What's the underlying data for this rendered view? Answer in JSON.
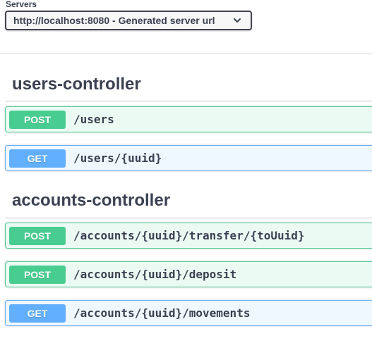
{
  "servers": {
    "label": "Servers",
    "selected": "http://localhost:8080 - Generated server url",
    "chevron_icon": "chevron-down-icon"
  },
  "sections": [
    {
      "title": "users-controller",
      "operations": [
        {
          "method": "POST",
          "path": "/users"
        },
        {
          "method": "GET",
          "path": "/users/{uuid}"
        }
      ]
    },
    {
      "title": "accounts-controller",
      "operations": [
        {
          "method": "POST",
          "path": "/accounts/{uuid}/transfer/{toUuid}"
        },
        {
          "method": "POST",
          "path": "/accounts/{uuid}/deposit"
        },
        {
          "method": "GET",
          "path": "/accounts/{uuid}/movements"
        }
      ]
    }
  ],
  "colors": {
    "post": "#49cc90",
    "get": "#61affe",
    "text": "#3b4151"
  }
}
